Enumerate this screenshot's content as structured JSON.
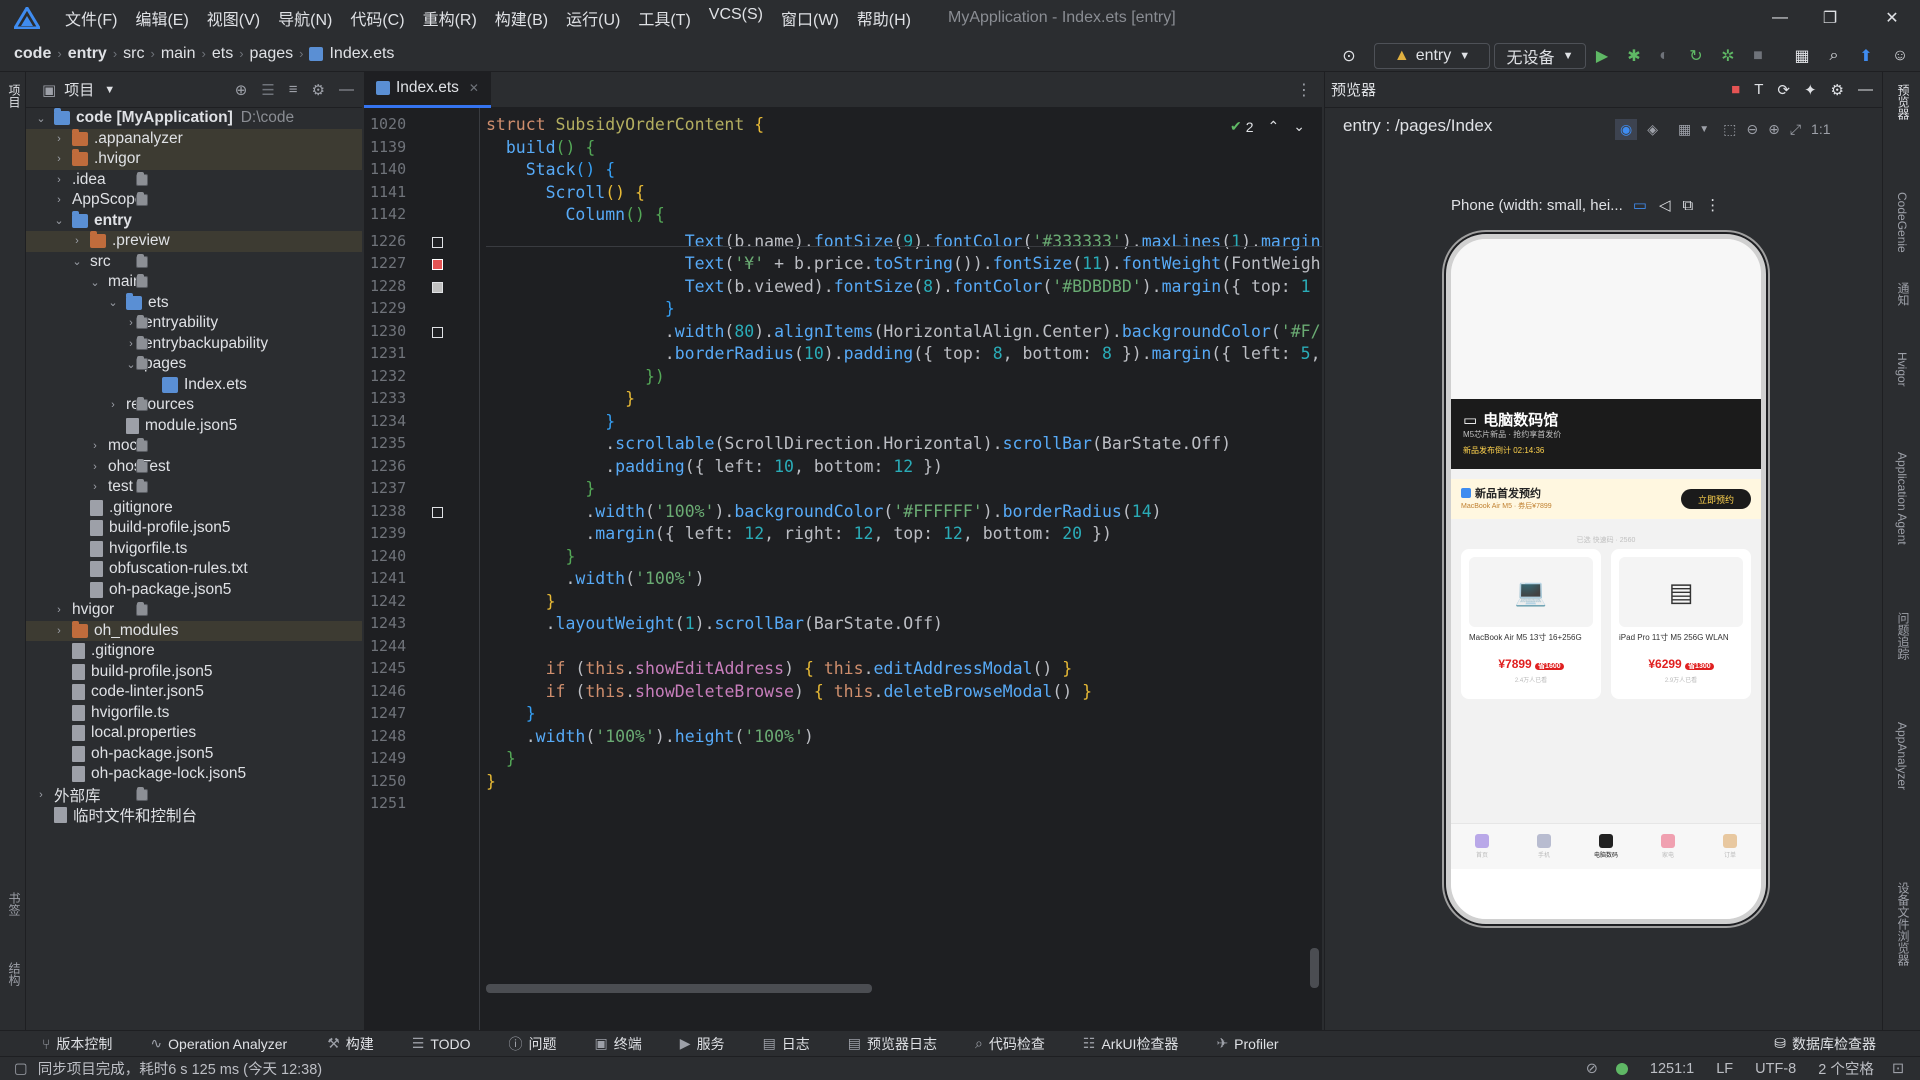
{
  "window": {
    "title": "MyApplication - Index.ets [entry]",
    "menus": [
      "文件(F)",
      "编辑(E)",
      "视图(V)",
      "导航(N)",
      "代码(C)",
      "重构(R)",
      "构建(B)",
      "运行(U)",
      "工具(T)",
      "VCS(S)",
      "窗口(W)",
      "帮助(H)"
    ]
  },
  "breadcrumb": [
    "code",
    "entry",
    "src",
    "main",
    "ets",
    "pages",
    "Index.ets"
  ],
  "toolbar": {
    "module": "entry",
    "device": "无设备"
  },
  "left_strip": {
    "top": "项目",
    "bottom1": "书签",
    "bottom2": "结构"
  },
  "project": {
    "header": "项目",
    "rows": [
      {
        "label": "code [MyApplication]",
        "extra": "D:\\code",
        "icon": "bfold",
        "depth": 0,
        "arrow": "down",
        "bold": true
      },
      {
        "label": ".appanalyzer",
        "icon": "ofold",
        "depth": 1,
        "arrow": "right",
        "hl": "sel"
      },
      {
        "label": ".hvigor",
        "icon": "ofold",
        "depth": 1,
        "arrow": "right",
        "hl": "sel"
      },
      {
        "label": ".idea",
        "icon": "fold",
        "depth": 1,
        "arrow": "right"
      },
      {
        "label": "AppScope",
        "icon": "fold",
        "depth": 1,
        "arrow": "right"
      },
      {
        "label": "entry",
        "icon": "bfold",
        "depth": 1,
        "arrow": "down",
        "bold": true
      },
      {
        "label": ".preview",
        "icon": "ofold",
        "depth": 2,
        "arrow": "right",
        "hl": "sel"
      },
      {
        "label": "src",
        "icon": "fold",
        "depth": 2,
        "arrow": "down"
      },
      {
        "label": "main",
        "icon": "fold",
        "depth": 3,
        "arrow": "down"
      },
      {
        "label": "ets",
        "icon": "bfold",
        "depth": 4,
        "arrow": "down"
      },
      {
        "label": "entryability",
        "icon": "fold",
        "depth": 5,
        "arrow": "right"
      },
      {
        "label": "entrybackupability",
        "icon": "fold",
        "depth": 5,
        "arrow": "right"
      },
      {
        "label": "pages",
        "icon": "fold",
        "depth": 5,
        "arrow": "down"
      },
      {
        "label": "Index.ets",
        "icon": "ets",
        "depth": 6,
        "arrow": ""
      },
      {
        "label": "resources",
        "icon": "fold",
        "depth": 4,
        "arrow": "right"
      },
      {
        "label": "module.json5",
        "icon": "file",
        "depth": 4,
        "arrow": ""
      },
      {
        "label": "mock",
        "icon": "fold",
        "depth": 3,
        "arrow": "right"
      },
      {
        "label": "ohosTest",
        "icon": "fold",
        "depth": 3,
        "arrow": "right"
      },
      {
        "label": "test",
        "icon": "fold",
        "depth": 3,
        "arrow": "right"
      },
      {
        "label": ".gitignore",
        "icon": "file",
        "depth": 2,
        "arrow": ""
      },
      {
        "label": "build-profile.json5",
        "icon": "file",
        "depth": 2,
        "arrow": ""
      },
      {
        "label": "hvigorfile.ts",
        "icon": "file",
        "depth": 2,
        "arrow": ""
      },
      {
        "label": "obfuscation-rules.txt",
        "icon": "file",
        "depth": 2,
        "arrow": ""
      },
      {
        "label": "oh-package.json5",
        "icon": "file",
        "depth": 2,
        "arrow": ""
      },
      {
        "label": "hvigor",
        "icon": "fold",
        "depth": 1,
        "arrow": "right"
      },
      {
        "label": "oh_modules",
        "icon": "ofold",
        "depth": 1,
        "arrow": "right",
        "hl": "sel"
      },
      {
        "label": ".gitignore",
        "icon": "file",
        "depth": 1,
        "arrow": ""
      },
      {
        "label": "build-profile.json5",
        "icon": "file",
        "depth": 1,
        "arrow": ""
      },
      {
        "label": "code-linter.json5",
        "icon": "file",
        "depth": 1,
        "arrow": ""
      },
      {
        "label": "hvigorfile.ts",
        "icon": "file",
        "depth": 1,
        "arrow": ""
      },
      {
        "label": "local.properties",
        "icon": "file",
        "depth": 1,
        "arrow": ""
      },
      {
        "label": "oh-package.json5",
        "icon": "file",
        "depth": 1,
        "arrow": ""
      },
      {
        "label": "oh-package-lock.json5",
        "icon": "file",
        "depth": 1,
        "arrow": ""
      },
      {
        "label": "外部库",
        "icon": "fold",
        "depth": 0,
        "arrow": "right"
      },
      {
        "label": "临时文件和控制台",
        "icon": "file",
        "depth": 0,
        "arrow": ""
      }
    ]
  },
  "editor": {
    "tab": "Index.ets",
    "inspection_count": "2",
    "lines": [
      {
        "n": "1020",
        "html": "<span class='kw'>struct</span> <span class='cls'>SubsidyOrderContent</span> <span class='br1'>{</span>"
      },
      {
        "n": "1139",
        "html": "  <span class='mt'>build</span><span class='br2'>()</span> <span class='br2'>{</span>"
      },
      {
        "n": "1140",
        "html": "    <span class='mt'>Stack</span><span class='br3'>()</span> <span class='br3'>{</span>"
      },
      {
        "n": "1141",
        "html": "      <span class='mt'>Scroll</span><span class='br1'>()</span> <span class='br1'>{</span>"
      },
      {
        "n": "1142",
        "html": "        <span class='mt'>Column</span><span class='br2'>()</span> <span class='br2'>{</span>"
      },
      {
        "n": "1226",
        "html": "                    <span class='mt'>Text</span>(b.name).<span class='mt'>fontSize</span>(<span class='num'>9</span>).<span class='mt'>fontColor</span>(<span class='str'>'#333333'</span>).<span class='mt'>maxLines</span>(<span class='num'>1</span>).<span class='mt'>margin</span>"
      },
      {
        "n": "1227",
        "html": "                    <span class='mt'>Text</span>(<span class='str'>'¥'</span> + b.price.<span class='mt'>toString</span>()).<span class='mt'>fontSize</span>(<span class='num'>11</span>).<span class='mt'>fontWeight</span>(FontWeigh"
      },
      {
        "n": "1228",
        "html": "                    <span class='mt'>Text</span>(b.viewed).<span class='mt'>fontSize</span>(<span class='num'>8</span>).<span class='mt'>fontColor</span>(<span class='str'>'#BDBDBD'</span>).<span class='mt'>margin</span>({ top: <span class='num'>1</span>"
      },
      {
        "n": "1229",
        "html": "                  <span class='br3'>}</span>"
      },
      {
        "n": "1230",
        "html": "                  .<span class='mt'>width</span>(<span class='num'>80</span>).<span class='mt'>alignItems</span>(HorizontalAlign.Center).<span class='mt'>backgroundColor</span>(<span class='str'>'#F/</span>"
      },
      {
        "n": "1231",
        "html": "                  .<span class='mt'>borderRadius</span>(<span class='num'>10</span>).<span class='mt'>padding</span>({ top: <span class='num'>8</span>, bottom: <span class='num'>8</span> }).<span class='mt'>margin</span>({ left: <span class='num'>5</span>,"
      },
      {
        "n": "1232",
        "html": "                <span class='br2'>})</span>"
      },
      {
        "n": "1233",
        "html": "              <span class='br1'>}</span>"
      },
      {
        "n": "1234",
        "html": "            <span class='br3'>}</span>"
      },
      {
        "n": "1235",
        "html": "            .<span class='mt'>scrollable</span>(ScrollDirection.Horizontal).<span class='mt'>scrollBar</span>(BarState.Off)"
      },
      {
        "n": "1236",
        "html": "            .<span class='mt'>padding</span>({ left: <span class='num'>10</span>, bottom: <span class='num'>12</span> })"
      },
      {
        "n": "1237",
        "html": "          <span class='br2'>}</span>"
      },
      {
        "n": "1238",
        "html": "          .<span class='mt'>width</span>(<span class='str'>'100%'</span>).<span class='mt'>backgroundColor</span>(<span class='str'>'#FFFFFF'</span>).<span class='mt'>borderRadius</span>(<span class='num'>14</span>)"
      },
      {
        "n": "1239",
        "html": "          .<span class='mt'>margin</span>({ left: <span class='num'>12</span>, right: <span class='num'>12</span>, top: <span class='num'>12</span>, bottom: <span class='num'>20</span> })"
      },
      {
        "n": "1240",
        "html": "        <span class='br2'>}</span>"
      },
      {
        "n": "1241",
        "html": "        .<span class='mt'>width</span>(<span class='str'>'100%'</span>)"
      },
      {
        "n": "1242",
        "html": "      <span class='br1'>}</span>"
      },
      {
        "n": "1243",
        "html": "      .<span class='mt'>layoutWeight</span>(<span class='num'>1</span>).<span class='mt'>scrollBar</span>(BarState.Off)"
      },
      {
        "n": "1244",
        "html": ""
      },
      {
        "n": "1245",
        "html": "      <span class='kw'>if</span> (<span class='kw'>this</span>.<span class='st'>showEditAddress</span>) <span class='br1'>{</span> <span class='kw'>this</span>.<span class='mt'>editAddressModal</span>() <span class='br1'>}</span>"
      },
      {
        "n": "1246",
        "html": "      <span class='kw'>if</span> (<span class='kw'>this</span>.<span class='st'>showDeleteBrowse</span>) <span class='br1'>{</span> <span class='kw'>this</span>.<span class='mt'>deleteBrowseModal</span>() <span class='br1'>}</span>"
      },
      {
        "n": "1247",
        "html": "    <span class='br3'>}</span>"
      },
      {
        "n": "1248",
        "html": "    .<span class='mt'>width</span>(<span class='str'>'100%'</span>).<span class='mt'>height</span>(<span class='str'>'100%'</span>)"
      },
      {
        "n": "1249",
        "html": "  <span class='br2'>}</span>"
      },
      {
        "n": "1250",
        "html": "<span class='br1'>}</span>"
      },
      {
        "n": "1251",
        "html": ""
      }
    ]
  },
  "preview": {
    "header": "预览器",
    "route": "entry : /pages/Index",
    "device_label": "Phone (width: small, hei...",
    "app": {
      "banner_title": "电脑数码馆",
      "banner_sub": "M5芯片新品 · 抢约享首发价",
      "countdown": "新品发布倒计 02:14:36",
      "promo_title": "新品首发预约",
      "promo_sub": "MacBook Air M5 · 券后¥7899",
      "promo_btn": "立即预约",
      "section": "已选 快速码 · 2560",
      "products": [
        {
          "name": "MacBook Air M5 13寸 16+256G",
          "price": "¥7899",
          "tag": "省1600",
          "sub": "2.4万人已看"
        },
        {
          "name": "iPad Pro 11寸 M5 256G WLAN",
          "price": "¥6299",
          "tag": "省1300",
          "sub": "2.9万人已看"
        }
      ],
      "tabs": [
        "首页",
        "手机",
        "电脑数码",
        "家电",
        "订单"
      ]
    }
  },
  "right_strip": [
    "预览器",
    "CodeGenie",
    "通知",
    "Hvigor",
    "Application Agent",
    "问题追踪",
    "AppAnalyzer",
    "设备文件浏览器"
  ],
  "bottom_tools": [
    "版本控制",
    "Operation Analyzer",
    "构建",
    "TODO",
    "问题",
    "终端",
    "服务",
    "日志",
    "预览器日志",
    "代码检查",
    "ArkUI检查器",
    "Profiler"
  ],
  "bottom_right": "数据库检查器",
  "status": {
    "message": "同步项目完成，耗时6 s 125 ms (今天 12:38)",
    "position": "1251:1",
    "line_sep": "LF",
    "encoding": "UTF-8",
    "indent": "2 个空格"
  }
}
